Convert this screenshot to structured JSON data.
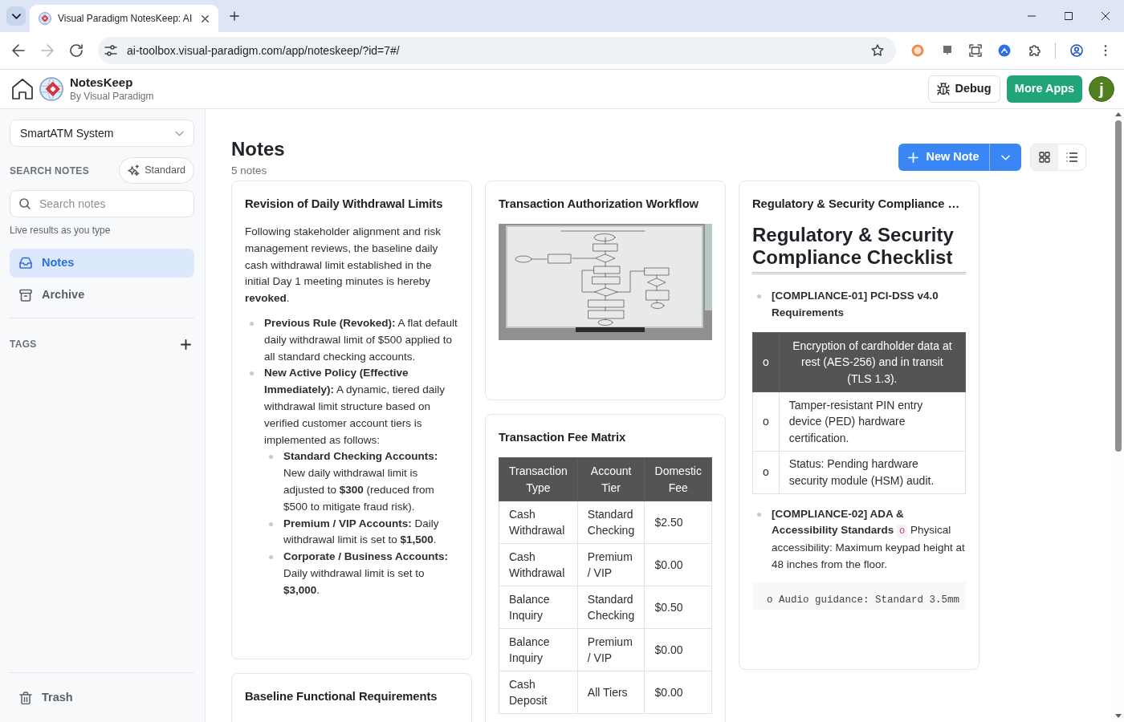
{
  "browser": {
    "tab_title": "Visual Paradigm NotesKeep: AI",
    "url": "ai-toolbox.visual-paradigm.com/app/noteskeep/?id=7#/",
    "forward_disabled": true
  },
  "header": {
    "app_name": "NotesKeep",
    "subtitle": "By Visual Paradigm",
    "buttons": [
      {
        "label": "Debug",
        "kind": "outline"
      },
      {
        "label": "More Apps",
        "kind": "success"
      }
    ],
    "avatar": "j"
  },
  "sidebar": {
    "project": "SmartATM System",
    "search_label": "SEARCH NOTES",
    "search_mode": "Standard",
    "search": {
      "placeholder": "Search notes"
    },
    "search_hint": "Live results as you type",
    "items": [
      {
        "label": "Notes",
        "selected": true
      },
      {
        "label": "Archive",
        "selected": false
      }
    ],
    "tags_label": "TAGS",
    "trash": "Trash"
  },
  "main": {
    "title": "Notes",
    "count": "5 notes",
    "new_note": "New Note",
    "views": [
      {
        "selected": true
      },
      {
        "selected": false
      }
    ]
  },
  "note_columns": [
    [
      {
        "title": "Revision of Daily Withdrawal Limits",
        "blocks": [
          {
            "kind": "paragraph",
            "text": "Following stakeholder alignment and risk management reviews, the baseline daily cash withdrawal limit established in the initial Day 1 meeting minutes is hereby **revoked**."
          },
          {
            "kind": "list",
            "items": [
              {
                "text": "**Previous Rule (Revoked):** A flat default daily withdrawal limit of $500 applied to all standard checking accounts."
              },
              {
                "text": "**New Active Policy (Effective Immediately):** A dynamic, tiered daily withdrawal limit structure based on verified customer account tiers is implemented as follows:",
                "children": [
                  {
                    "text": "**Standard Checking Accounts:** New daily withdrawal limit is adjusted to **$300** (reduced from $500 to mitigate fraud risk)."
                  },
                  {
                    "text": "**Premium / VIP Accounts:** Daily withdrawal limit is set to **$1,500**."
                  },
                  {
                    "text": "**Corporate / Business Accounts:** Daily withdrawal limit is set to **$3,000**."
                  }
                ]
              }
            ]
          }
        ]
      },
      {
        "title": "Baseline Functional Requirements"
      }
    ],
    [
      {
        "title": "Transaction Authorization Workflow",
        "blocks": [
          {
            "kind": "photo"
          }
        ]
      },
      {
        "title": "Transaction Fee Matrix",
        "blocks": [
          {
            "kind": "table",
            "header": [
              "Transaction Type",
              "Account Tier",
              "Domestic Fee"
            ],
            "rows": [
              [
                "Cash Withdrawal",
                "Standard Checking",
                "$2.50"
              ],
              [
                "Cash Withdrawal",
                "Premium / VIP",
                "$0.00"
              ],
              [
                "Balance Inquiry",
                "Standard Checking",
                "$0.50"
              ],
              [
                "Balance Inquiry",
                "Premium / VIP",
                "$0.00"
              ],
              [
                "Cash Deposit",
                "All Tiers",
                "$0.00"
              ]
            ]
          }
        ]
      }
    ],
    [
      {
        "title": "Regulatory & Security Compliance …",
        "blocks": [
          {
            "kind": "heading",
            "text": "Regulatory & Security Compliance Checklist"
          },
          {
            "kind": "list",
            "items": [
              {
                "lead": "[COMPLIANCE-01] PCI-DSS v4.0 Requirements"
              }
            ]
          },
          {
            "kind": "table",
            "header": [
              "o",
              "Encryption of cardholder data at rest (AES-256) and in transit (TLS 1.3)."
            ],
            "rows": [
              [
                "o",
                "Tamper-resistant PIN entry device (PED) hardware certification."
              ],
              [
                "o",
                "Status: Pending hardware security module (HSM) audit."
              ]
            ]
          },
          {
            "kind": "list",
            "items": [
              {
                "lead": "[COMPLIANCE-02] ADA & Accessibility Standards",
                "code": "o",
                "text": "Physical accessibility: Maximum keypad height at 48 inches from the floor."
              }
            ]
          },
          {
            "kind": "code",
            "text": "o Audio guidance: Standard 3.5mm"
          }
        ]
      }
    ]
  ]
}
